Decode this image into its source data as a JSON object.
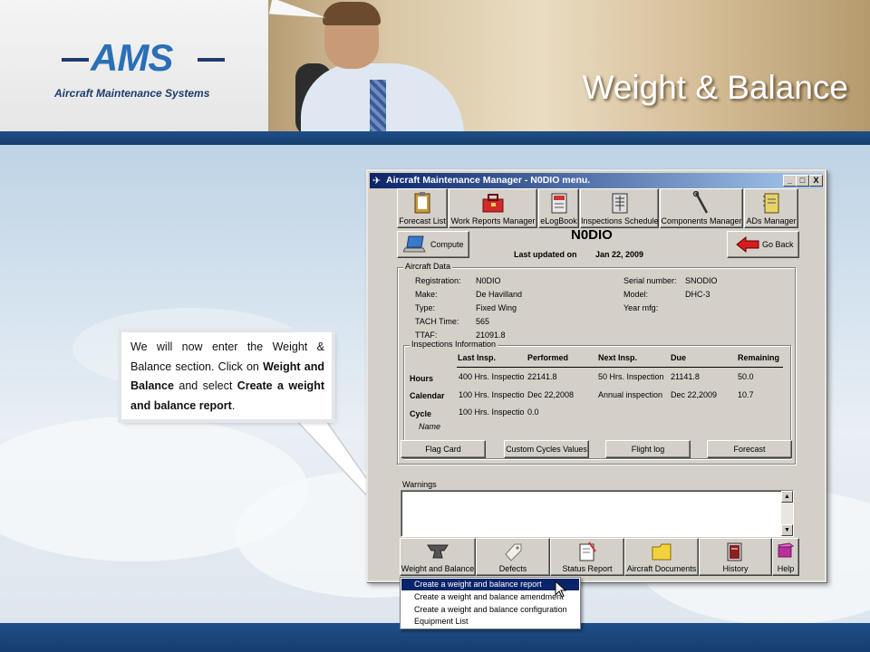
{
  "slide": {
    "title": "Weight & Balance",
    "logo_text": "AMS",
    "logo_subtitle": "Aircraft Maintenance Systems"
  },
  "callout": {
    "intro": "We will now enter the Weight & Balance section. Click on ",
    "strong1": "Weight and Balance",
    "middle": " and select ",
    "strong2": "Create a weight and balance report",
    "end": "."
  },
  "window": {
    "title": "Aircraft Maintenance Manager - N0DIO menu.",
    "controls": [
      "_",
      "□",
      "X"
    ]
  },
  "toolbar": {
    "items": [
      {
        "label": "Forecast List",
        "icon": "clipboard-icon"
      },
      {
        "label": "Work Reports Manager",
        "icon": "toolbox-icon"
      },
      {
        "label": "eLogBook",
        "icon": "logbook-icon"
      },
      {
        "label": "Inspections Schedule",
        "icon": "schedule-icon"
      },
      {
        "label": "Components Manager",
        "icon": "wrench-icon"
      },
      {
        "label": "ADs Manager",
        "icon": "notebook-icon"
      }
    ]
  },
  "header": {
    "compute_label": "Compute",
    "aircraft_id": "N0DIO",
    "last_updated_label": "Last updated on",
    "last_updated_value": "Jan 22, 2009",
    "go_back_label": "Go Back"
  },
  "aircraft_data": {
    "group_title": "Aircraft Data",
    "fields": [
      {
        "label": "Registration:",
        "value": "N0DIO"
      },
      {
        "label": "Make:",
        "value": "De Havilland"
      },
      {
        "label": "Type:",
        "value": "Fixed Wing"
      },
      {
        "label": "TACH Time:",
        "value": "565"
      },
      {
        "label": "TTAF:",
        "value": "21091.8"
      }
    ],
    "right_fields": [
      {
        "label": "Serial number:",
        "value": "SNODIO"
      },
      {
        "label": "Model:",
        "value": "DHC-3"
      },
      {
        "label": "Year mfg:",
        "value": ""
      }
    ]
  },
  "inspections": {
    "group_title": "Inspections Information",
    "headers": [
      "Last Insp.",
      "Performed",
      "Next Insp.",
      "Due",
      "Remaining"
    ],
    "rows": [
      {
        "label": "Hours",
        "last": "400 Hrs. Inspectio",
        "performed": "22141.8",
        "next": "50 Hrs. Inspection",
        "due": "21141.8",
        "remaining": "50.0"
      },
      {
        "label": "Calendar",
        "last": "100 Hrs. Inspectio",
        "performed": "Dec 22,2008",
        "next": "Annual inspection",
        "due": "Dec 22,2009",
        "remaining": "10.7"
      },
      {
        "label": "Cycle",
        "last": "100 Hrs. Inspectio",
        "performed": "0.0",
        "next": "",
        "due": "",
        "remaining": ""
      }
    ],
    "name_label": "Name",
    "buttons": [
      "Flag Card",
      "Custom Cycles Values",
      "Flight log",
      "Forecast"
    ]
  },
  "warnings": {
    "label": "Warnings",
    "text": ""
  },
  "bottom_toolbar": {
    "items": [
      {
        "label": "Weight and Balance",
        "icon": "anvil-icon"
      },
      {
        "label": "Defects",
        "icon": "tag-icon"
      },
      {
        "label": "Status Report",
        "icon": "report-icon"
      },
      {
        "label": "Aircraft Documents",
        "icon": "folder-icon"
      },
      {
        "label": "History",
        "icon": "history-icon"
      },
      {
        "label": "Help",
        "icon": "book-icon"
      }
    ]
  },
  "dropdown": {
    "items": [
      "Create a weight and balance report",
      "Create a weight and balance amendment",
      "Create a weight and balance configuration",
      "Equipment List"
    ],
    "selected_index": 0
  },
  "colors": {
    "titlebar": "#0a246a",
    "slide_title": "#ffffff",
    "footer_bar": "#1f4f88",
    "selection": "#0a246a"
  }
}
